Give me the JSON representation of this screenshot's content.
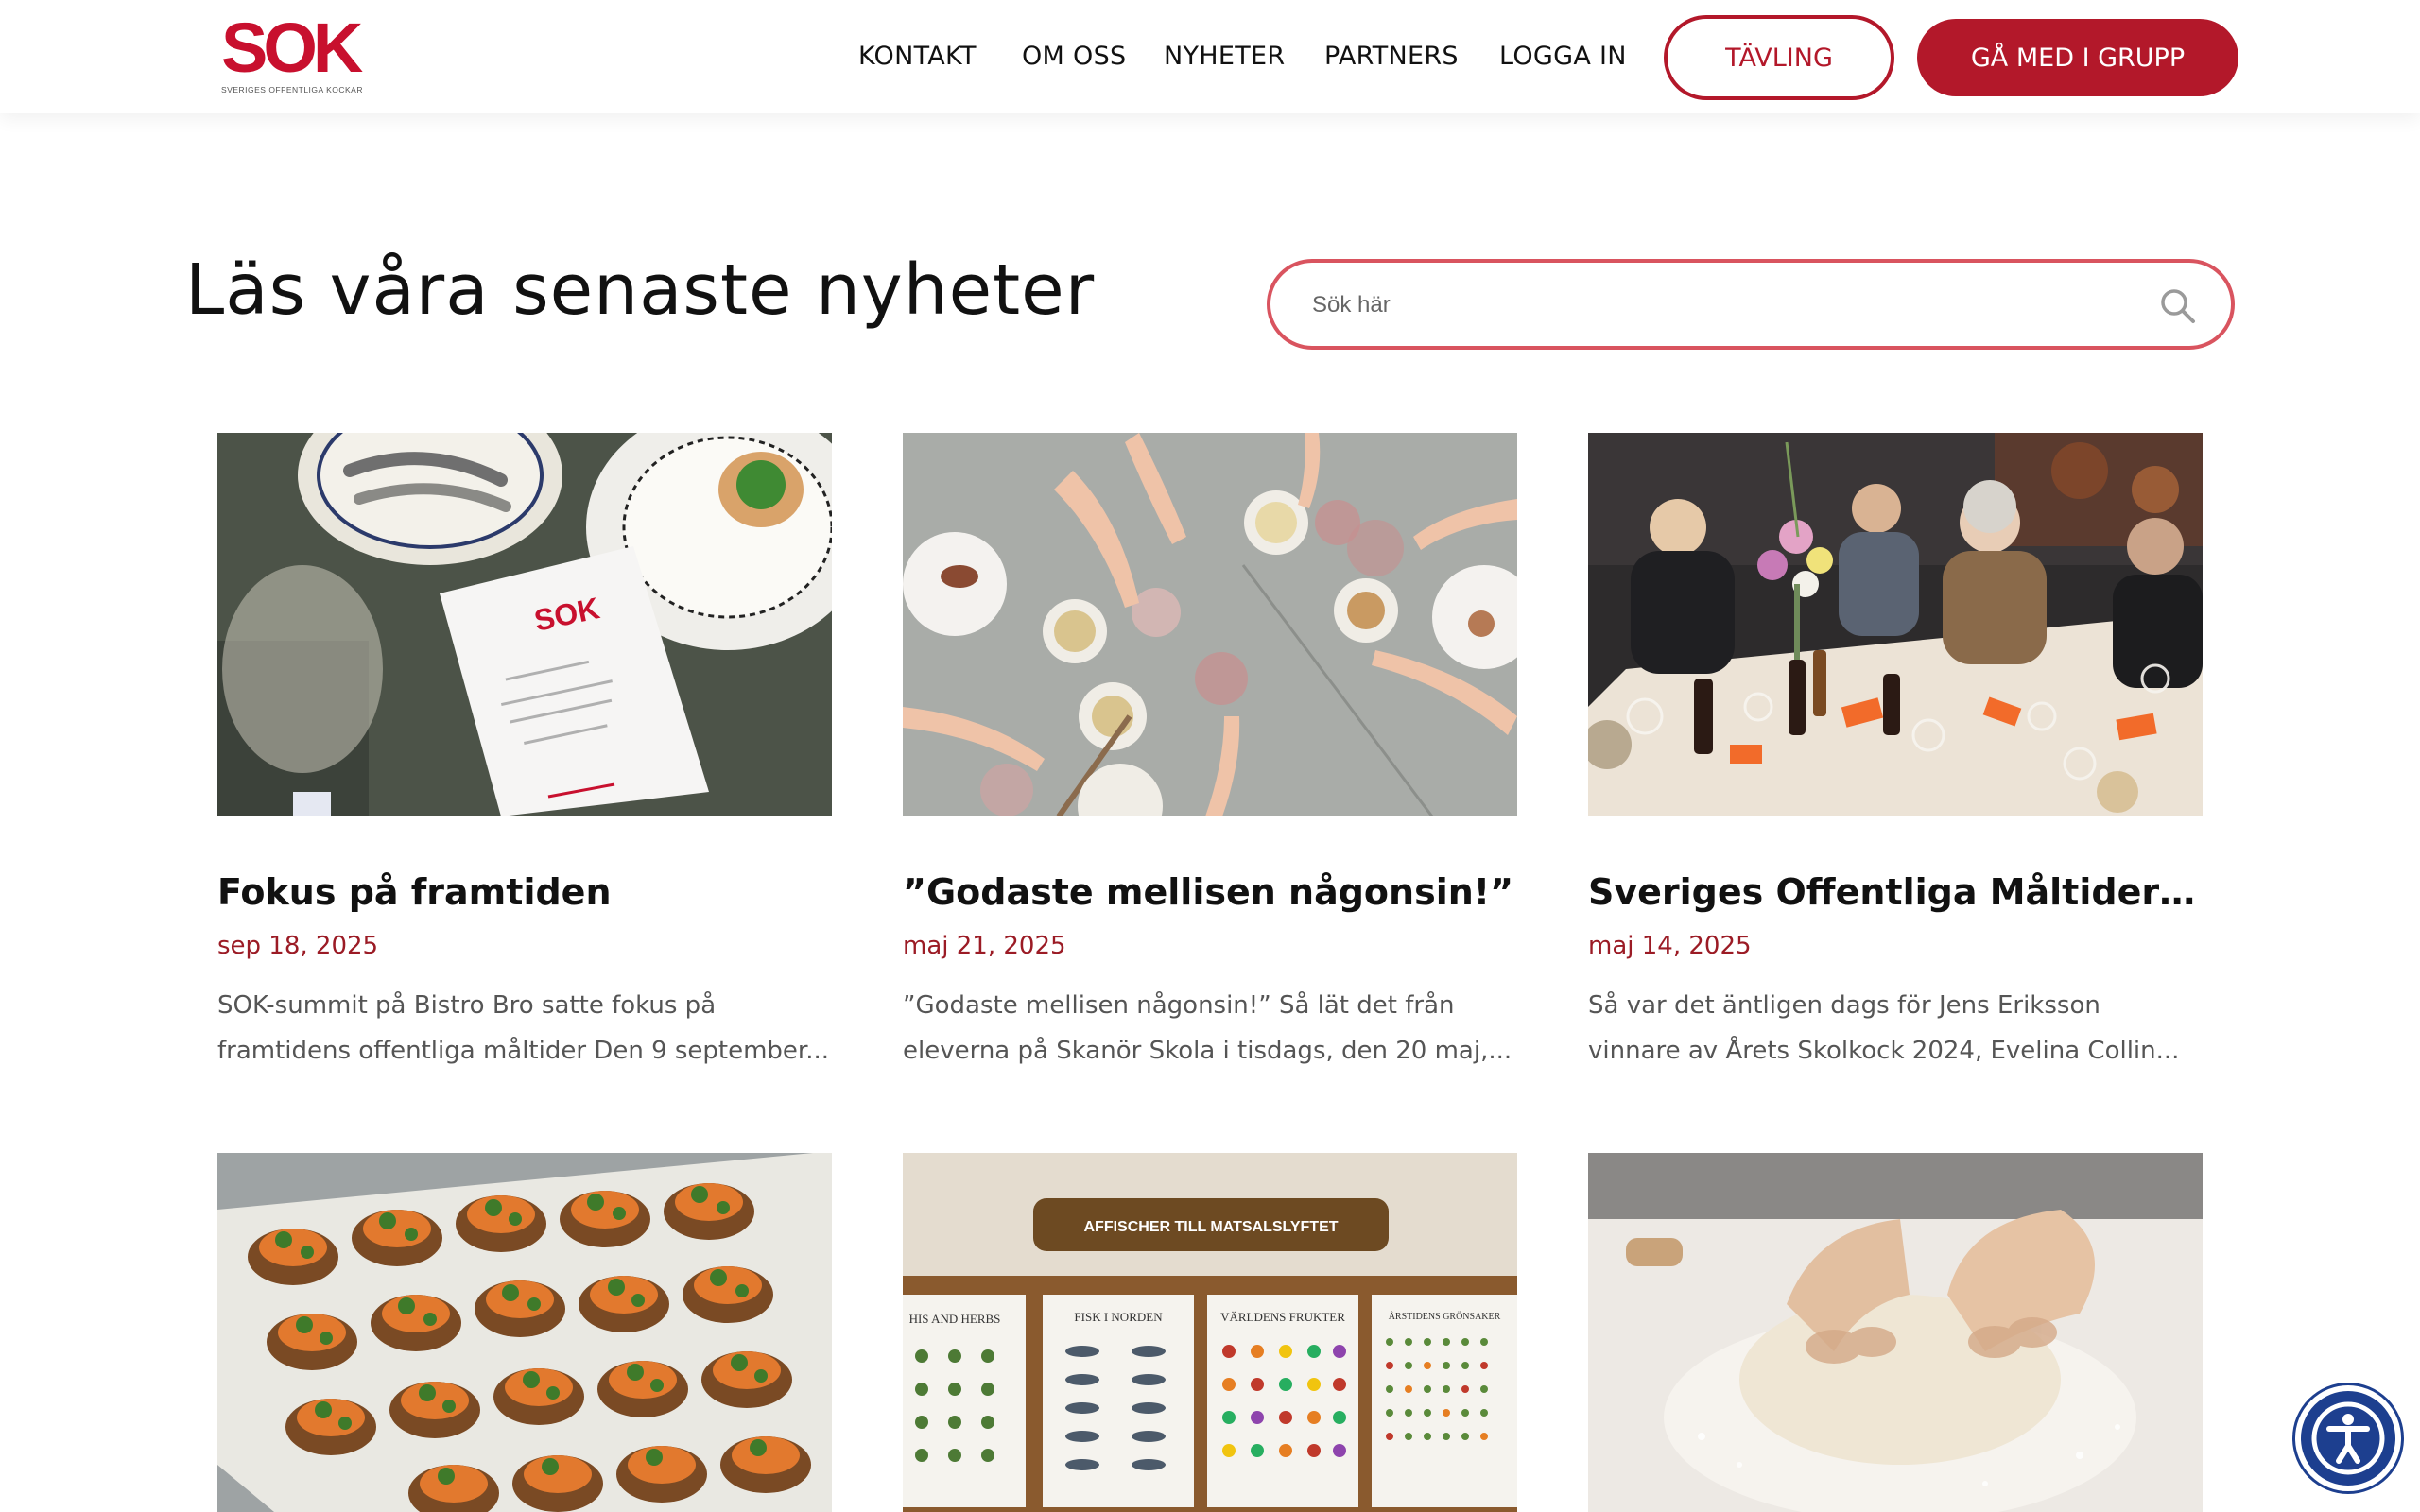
{
  "header": {
    "logo": {
      "mark": "SOK",
      "tagline": "SVERIGES OFFENTLIGA KOCKAR"
    },
    "nav": [
      "KONTAKT",
      "OM OSS",
      "NYHETER",
      "PARTNERS",
      "LOGGA IN"
    ],
    "contest_button": "TÄVLING",
    "join_button": "GÅ MED I GRUPP"
  },
  "main": {
    "title": "Läs våra senaste nyheter",
    "search": {
      "placeholder": "Sök här"
    },
    "posts": [
      {
        "title": "Fokus på framtiden",
        "date": "sep 18, 2025",
        "excerpt_line1": "SOK-summit på Bistro Bro satte fokus på",
        "excerpt_line2": "framtidens offentliga måltider Den 9 september...",
        "image_text": "SOK"
      },
      {
        "title": "”Godaste mellisen någonsin!”",
        "date": "maj 21, 2025",
        "excerpt_line1": "”Godaste mellisen någonsin!” Så lät det från",
        "excerpt_line2": "eleverna på Skanör Skola i tisdags, den 20 maj,..."
      },
      {
        "title": "Sveriges Offentliga Måltider –...",
        "date": "maj 14, 2025",
        "excerpt_line1": "Så var det äntligen dags för Jens Eriksson",
        "excerpt_line2": "vinnare av Årets Skolkock 2024, Evelina Collin..."
      }
    ],
    "poster_image": {
      "banner": "AFFISCHER TILL MATSALSLYFTET",
      "posters": [
        "HIS AND HERBS",
        "FISK I NORDEN",
        "VÄRLDENS FRUKTER",
        "ÅRSTIDENS GRÖNSAKER"
      ]
    }
  },
  "colors": {
    "brand_red": "#b3182a",
    "date_red": "#9b1b25",
    "accessibility_blue": "#1d3f8f"
  },
  "icons": {
    "search": "magnifier-icon",
    "accessibility": "accessibility-person-icon"
  }
}
